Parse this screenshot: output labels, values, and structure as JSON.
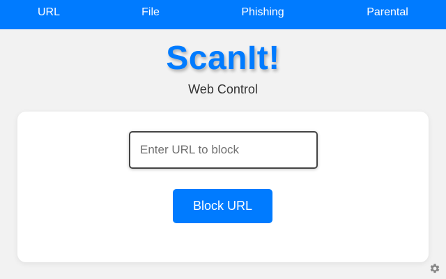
{
  "nav": {
    "items": [
      {
        "label": "URL"
      },
      {
        "label": "File"
      },
      {
        "label": "Phishing"
      },
      {
        "label": "Parental"
      }
    ]
  },
  "brand": {
    "title": "ScanIt!",
    "subtitle": "Web Control"
  },
  "form": {
    "url_placeholder": "Enter URL to block",
    "url_value": "",
    "block_button_label": "Block URL"
  },
  "footer": {
    "settings_icon": "gear-icon"
  },
  "colors": {
    "accent": "#007bff",
    "background": "#f2f2f2",
    "card": "#ffffff",
    "icon": "#888888"
  }
}
